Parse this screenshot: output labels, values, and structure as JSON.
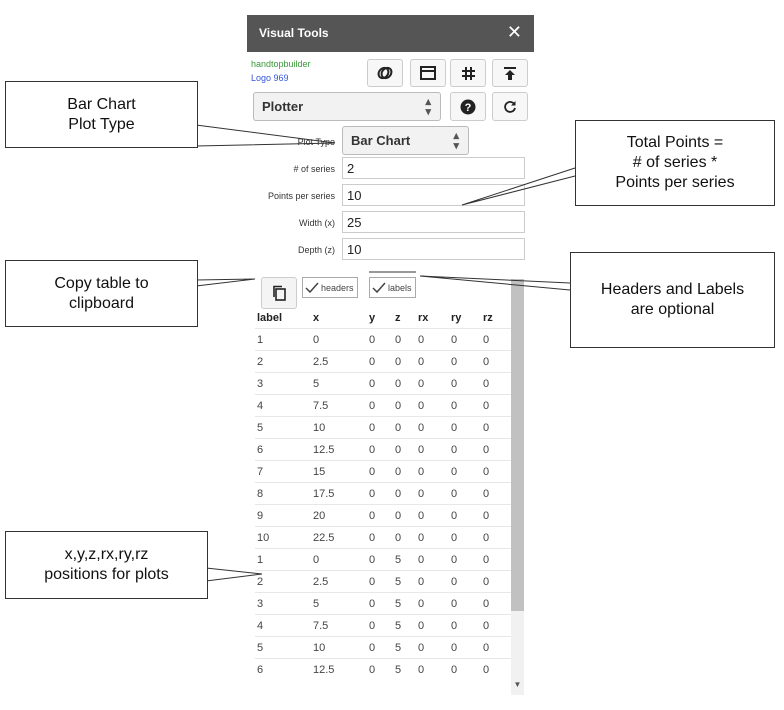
{
  "panel": {
    "title": "Visual Tools",
    "close_icon": "close-icon",
    "owner": "handtopbuilder",
    "logo_link": "Logo 969",
    "toolbar": [
      "link-icon",
      "window-icon",
      "grid-icon",
      "upload-icon"
    ],
    "mode_select": "Plotter",
    "help_icon": "help-icon",
    "refresh_icon": "refresh-icon"
  },
  "form": {
    "plot_type_label": "Plot Type",
    "plot_type_value": "Bar Chart",
    "series_label": "# of series",
    "series_value": "2",
    "points_label": "Points per series",
    "points_value": "10",
    "width_label": "Width (x)",
    "width_value": "25",
    "depth_label": "Depth (z)",
    "depth_value": "10"
  },
  "controls": {
    "copy_icon": "copy-icon",
    "headers_label": "headers",
    "headers_checked": true,
    "labels_label": "labels",
    "labels_checked": true
  },
  "table": {
    "columns": [
      "label",
      "x",
      "y",
      "z",
      "rx",
      "ry",
      "rz"
    ],
    "rows": [
      [
        "1",
        "0",
        "0",
        "0",
        "0",
        "0",
        "0"
      ],
      [
        "2",
        "2.5",
        "0",
        "0",
        "0",
        "0",
        "0"
      ],
      [
        "3",
        "5",
        "0",
        "0",
        "0",
        "0",
        "0"
      ],
      [
        "4",
        "7.5",
        "0",
        "0",
        "0",
        "0",
        "0"
      ],
      [
        "5",
        "10",
        "0",
        "0",
        "0",
        "0",
        "0"
      ],
      [
        "6",
        "12.5",
        "0",
        "0",
        "0",
        "0",
        "0"
      ],
      [
        "7",
        "15",
        "0",
        "0",
        "0",
        "0",
        "0"
      ],
      [
        "8",
        "17.5",
        "0",
        "0",
        "0",
        "0",
        "0"
      ],
      [
        "9",
        "20",
        "0",
        "0",
        "0",
        "0",
        "0"
      ],
      [
        "10",
        "22.5",
        "0",
        "0",
        "0",
        "0",
        "0"
      ],
      [
        "1",
        "0",
        "0",
        "5",
        "0",
        "0",
        "0"
      ],
      [
        "2",
        "2.5",
        "0",
        "5",
        "0",
        "0",
        "0"
      ],
      [
        "3",
        "5",
        "0",
        "5",
        "0",
        "0",
        "0"
      ],
      [
        "4",
        "7.5",
        "0",
        "5",
        "0",
        "0",
        "0"
      ],
      [
        "5",
        "10",
        "0",
        "5",
        "0",
        "0",
        "0"
      ],
      [
        "6",
        "12.5",
        "0",
        "5",
        "0",
        "0",
        "0"
      ]
    ]
  },
  "callouts": {
    "bar_chart": [
      "Bar Chart",
      "Plot Type"
    ],
    "total_points": [
      "Total Points =",
      "# of series *",
      "Points per series"
    ],
    "copy_table": [
      "Copy table to",
      "clipboard"
    ],
    "headers_labels": [
      "Headers and Labels",
      "are optional"
    ],
    "positions": [
      "x,y,z,rx,ry,rz",
      "positions for plots"
    ]
  }
}
